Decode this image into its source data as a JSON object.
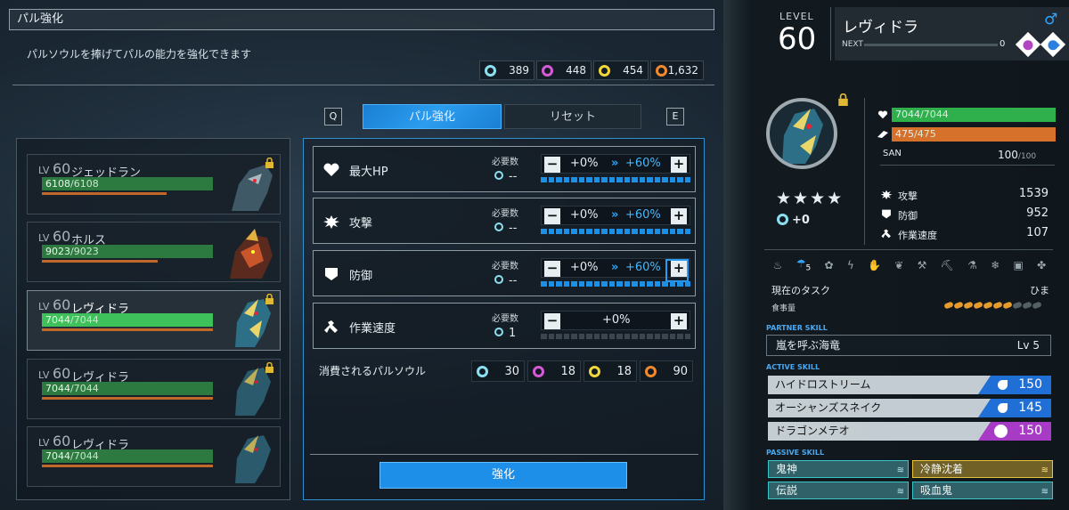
{
  "window": {
    "title": "パル強化",
    "subtitle": "パルソウルを捧げてパルの能力を強化できます"
  },
  "currency": [
    {
      "color": "#8be0f0",
      "value": "389",
      "icon": "pal-soul-small-icon"
    },
    {
      "color": "#d65ad6",
      "value": "448",
      "icon": "pal-soul-medium-icon"
    },
    {
      "color": "#f0d83a",
      "value": "454",
      "icon": "pal-soul-large-icon"
    },
    {
      "color": "#f28a2c",
      "value": "1,632",
      "icon": "pal-soul-xl-icon"
    }
  ],
  "tabs": {
    "left_key": "Q",
    "right_key": "E",
    "enhance": "パル強化",
    "reset": "リセット"
  },
  "pals": [
    {
      "lv_prefix": "LV",
      "lv": "60",
      "name": "ジェッドラン",
      "hp": "6108",
      "hp_max": "/6108",
      "locked": true
    },
    {
      "lv_prefix": "LV",
      "lv": "60",
      "name": "ホルス",
      "hp": "9023",
      "hp_max": "/9023",
      "locked": false
    },
    {
      "lv_prefix": "LV",
      "lv": "60",
      "name": "レヴィドラ",
      "hp": "7044",
      "hp_max": "/7044",
      "locked": true,
      "selected": true
    },
    {
      "lv_prefix": "LV",
      "lv": "60",
      "name": "レヴィドラ",
      "hp": "7044",
      "hp_max": "/7044",
      "locked": true
    },
    {
      "lv_prefix": "LV",
      "lv": "60",
      "name": "レヴィドラ",
      "hp": "7044",
      "hp_max": "/7044",
      "locked": false
    }
  ],
  "stats": [
    {
      "icon": "heart-icon",
      "name": "最大HP",
      "need_label": "必要数",
      "need": "--",
      "current": "+0%",
      "max": "+60%",
      "filled": true
    },
    {
      "icon": "attack-icon",
      "name": "攻撃",
      "need_label": "必要数",
      "need": "--",
      "current": "+0%",
      "max": "+60%",
      "filled": true
    },
    {
      "icon": "shield-icon",
      "name": "防御",
      "need_label": "必要数",
      "need": "--",
      "current": "+0%",
      "max": "+60%",
      "filled": true
    },
    {
      "icon": "work-speed-icon",
      "name": "作業速度",
      "need_label": "必要数",
      "need": "1",
      "current": "+0%",
      "max": "",
      "filled": false
    }
  ],
  "consumed": {
    "label": "消費されるパルソウル",
    "values": [
      "30",
      "18",
      "18",
      "90"
    ]
  },
  "enhance_button": "強化",
  "detail": {
    "level_label": "LEVEL",
    "level": "60",
    "name": "レヴィドラ",
    "next_label": "NEXT",
    "next_value": "0",
    "gender": "♂",
    "elements": [
      {
        "color": "#b344c2",
        "name": "dragon-element-icon"
      },
      {
        "color": "#2a7fe0",
        "name": "water-element-icon"
      }
    ],
    "stars": "★★★★",
    "soul_bonus": "+0",
    "hp": "7044",
    "hp_max": "/7044",
    "stamina": "475",
    "stamina_max": "/475",
    "san_label": "SAN",
    "san": "100",
    "san_max": "/100",
    "stats": [
      {
        "icon": "attack-icon",
        "label": "攻撃",
        "value": "1539"
      },
      {
        "icon": "shield-icon",
        "label": "防御",
        "value": "952"
      },
      {
        "icon": "work-speed-icon",
        "label": "作業速度",
        "value": "107"
      }
    ],
    "work_level": "5",
    "task_label": "現在のタスク",
    "task_value": "ひま",
    "food_label": "食事量",
    "food_filled": 7,
    "food_total": 10,
    "partner_label": "PARTNER SKILL",
    "partner_skill": "嵐を呼ぶ海竜",
    "partner_lv": "Lv 5",
    "active_label": "ACTIVE SKILL",
    "active": [
      {
        "name": "ハイドロストリーム",
        "power": "150",
        "color": "#1f6fd6"
      },
      {
        "name": "オーシャンズスネイク",
        "power": "145",
        "color": "#1f6fd6"
      },
      {
        "name": "ドラゴンメテオ",
        "power": "150",
        "color": "#a73bc6"
      }
    ],
    "passive_label": "PASSIVE SKILL",
    "passive": [
      {
        "name": "鬼神",
        "gold": false
      },
      {
        "name": "冷静沈着",
        "gold": true
      },
      {
        "name": "伝説",
        "gold": false
      },
      {
        "name": "吸血鬼",
        "gold": false
      }
    ]
  }
}
